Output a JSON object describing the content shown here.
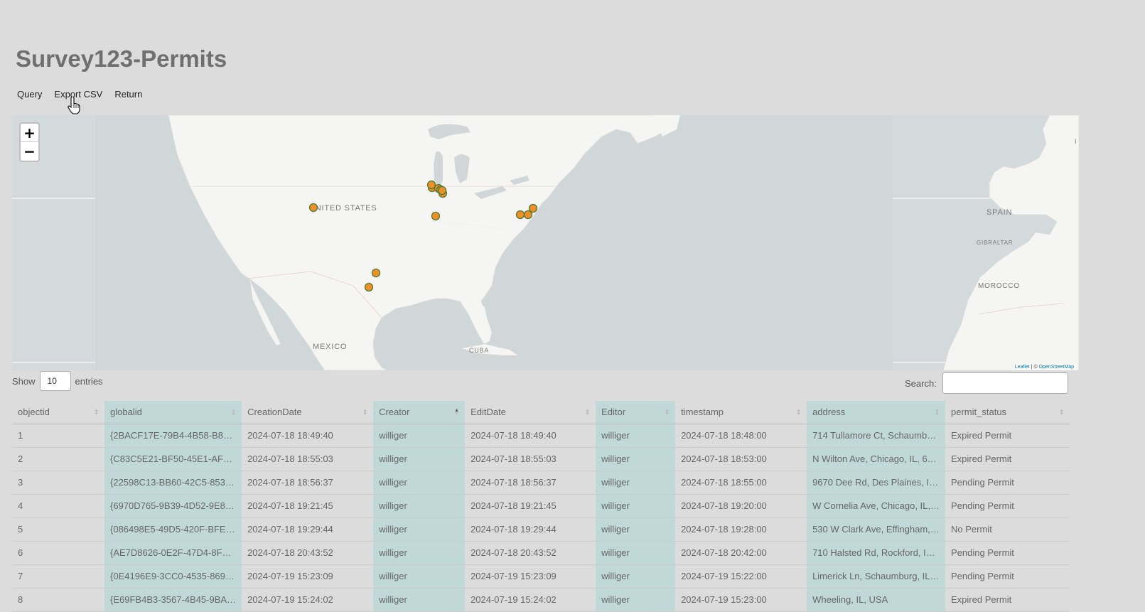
{
  "page": {
    "title": "Survey123-Permits"
  },
  "menu": {
    "items": [
      "Query",
      "Export CSV",
      "Return"
    ]
  },
  "map": {
    "zoom_in": "+",
    "zoom_out": "−",
    "labels": {
      "united_states": "UNITED STATES",
      "mexico": "MEXICO",
      "cuba": "CUBA",
      "spain": "SPAIN",
      "gibraltar": "GIBRALTAR",
      "morocco": "MOROCCO"
    },
    "attribution": {
      "leaflet": "Leaflet",
      "sep": " | © ",
      "osm": "OpenStreetMap"
    },
    "marker_color": "#ef8f2a"
  },
  "table_controls": {
    "show": "Show",
    "length_value": "10",
    "entries": "entries",
    "search_label": "Search:"
  },
  "table": {
    "columns": [
      "objectid",
      "globalid",
      "CreationDate",
      "Creator",
      "EditDate",
      "Editor",
      "timestamp",
      "address",
      "permit_status"
    ],
    "rows": [
      [
        "1",
        "{2BACF17E-79B4-4B58-B8…",
        "2024-07-18 18:49:40",
        "williger",
        "2024-07-18 18:49:40",
        "williger",
        "2024-07-18 18:48:00",
        "714 Tullamore Ct, Schaumb…",
        "Expired Permit"
      ],
      [
        "2",
        "{C83C5E21-BF50-45E1-AF…",
        "2024-07-18 18:55:03",
        "williger",
        "2024-07-18 18:55:03",
        "williger",
        "2024-07-18 18:53:00",
        "N Wilton Ave, Chicago, IL, 6…",
        "Expired Permit"
      ],
      [
        "3",
        "{22598C13-BB60-42C5-853…",
        "2024-07-18 18:56:37",
        "williger",
        "2024-07-18 18:56:37",
        "williger",
        "2024-07-18 18:55:00",
        "9670 Dee Rd, Des Plaines, I…",
        "Pending Permit"
      ],
      [
        "4",
        "{6970D765-9B39-4D52-9E8…",
        "2024-07-18 19:21:45",
        "williger",
        "2024-07-18 19:21:45",
        "williger",
        "2024-07-18 19:20:00",
        "W Cornelia Ave, Chicago, IL,…",
        "Pending Permit"
      ],
      [
        "5",
        "{086498E5-49D5-420F-BFE…",
        "2024-07-18 19:29:44",
        "williger",
        "2024-07-18 19:29:44",
        "williger",
        "2024-07-18 19:28:00",
        "530 W Clark Ave, Effingham,…",
        "No Permit"
      ],
      [
        "6",
        "{AE7D8626-0E2F-47D4-8F…",
        "2024-07-18 20:43:52",
        "williger",
        "2024-07-18 20:43:52",
        "williger",
        "2024-07-18 20:42:00",
        "710 Halsted Rd, Rockford, I…",
        "Pending Permit"
      ],
      [
        "7",
        "{0E4196E9-3CC0-4535-869…",
        "2024-07-19 15:23:09",
        "williger",
        "2024-07-19 15:23:09",
        "williger",
        "2024-07-19 15:22:00",
        "Limerick Ln, Schaumburg, IL…",
        "Pending Permit"
      ],
      [
        "8",
        "{E69FB4B3-3567-4B45-9BA…",
        "2024-07-19 15:24:02",
        "williger",
        "2024-07-19 15:24:02",
        "williger",
        "2024-07-19 15:23:00",
        "Wheeling, IL, USA",
        "Expired Permit"
      ]
    ]
  }
}
